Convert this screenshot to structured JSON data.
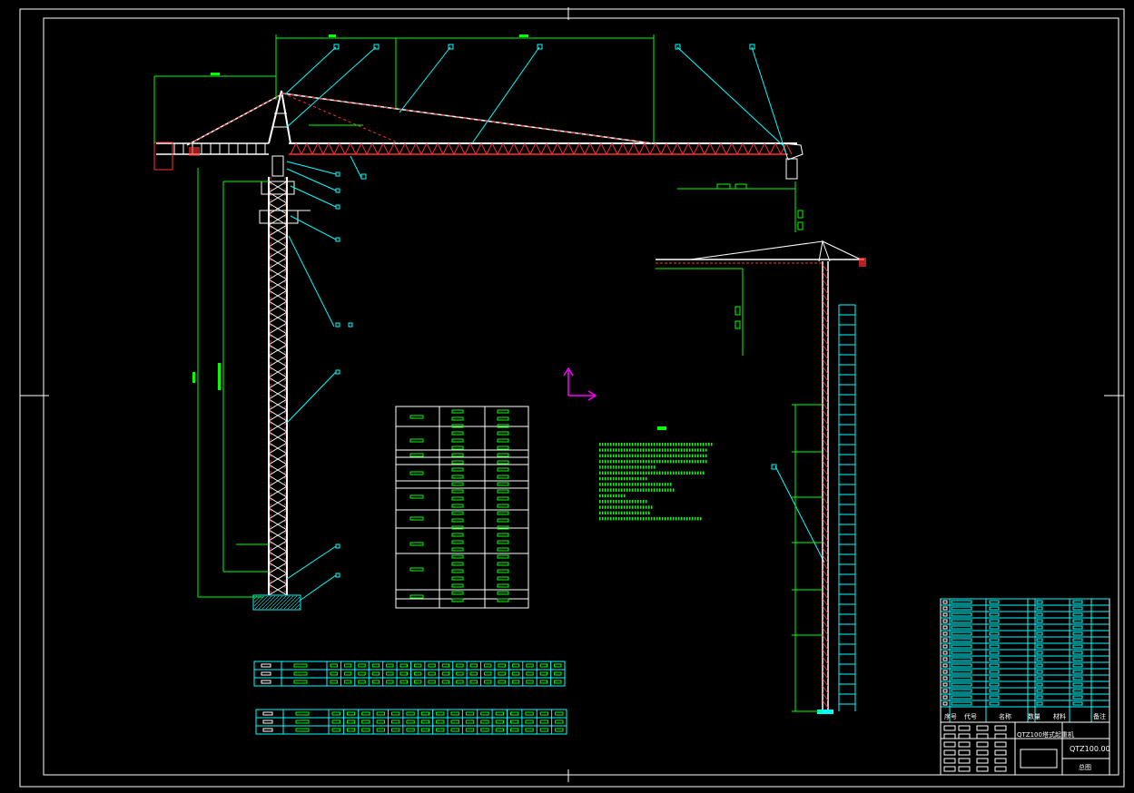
{
  "drawing": {
    "colors": {
      "background": "#000000",
      "frame": "#ffffff",
      "dimension": "#00ff00",
      "leader": "#00ffff",
      "tower": "#ffffff",
      "tower_accent": "#ff3030",
      "ucs": "#ff00ff",
      "table": "#00ffff"
    },
    "title_block": {
      "header_labels": [
        "序号",
        "代号",
        "名称",
        "数量",
        "材料",
        "备注"
      ],
      "drawing_title": "QTZ100塔式起重机",
      "drawing_number": "QTZ100.00",
      "sheet_note": "总图"
    }
  }
}
